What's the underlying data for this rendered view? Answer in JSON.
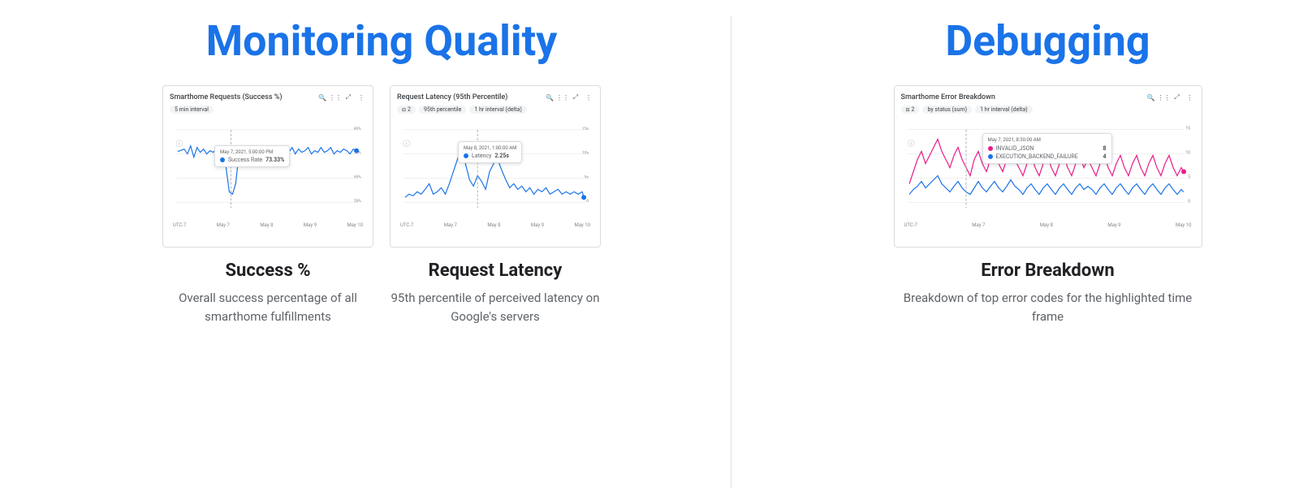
{
  "left_section": {
    "title": "Monitoring Quality",
    "charts": [
      {
        "id": "success-rate-chart",
        "title": "Smarthome Requests (Success %)",
        "filters": [
          "5 min interval"
        ],
        "tooltip": {
          "date": "May 7, 2021, 5:00:00 PM",
          "metric": "Success Rate",
          "value": "73.33%"
        },
        "y_labels": [
          "80%",
          "70%",
          "60%",
          "50%"
        ],
        "x_labels": [
          "UTC-7",
          "May 7",
          "May 8",
          "May 9",
          "May 10"
        ],
        "line_color": "#1a73e8"
      },
      {
        "id": "latency-chart",
        "title": "Request Latency (95th Percentile)",
        "filters": [
          "2",
          "95th percentile",
          "1 hr interval (delta)"
        ],
        "tooltip": {
          "date": "May 8, 2021, 1:00:00 AM",
          "metric": "Latency",
          "value": "2.25s"
        },
        "y_labels": [
          "15s",
          "10s",
          "5s",
          "0"
        ],
        "x_labels": [
          "UTC-7",
          "May 7",
          "May 8",
          "May 9",
          "May 10"
        ],
        "line_color": "#1a73e8"
      }
    ],
    "info": [
      {
        "title": "Success %",
        "description": "Overall success percentage of all smarthome fulfillments"
      },
      {
        "title": "Request Latency",
        "description": "95th percentile of perceived latency on Google's servers"
      }
    ]
  },
  "right_section": {
    "title": "Debugging",
    "chart": {
      "id": "error-breakdown-chart",
      "title": "Smarthome Error Breakdown",
      "filters": [
        "2",
        "by status (sum)",
        "1 hr interval (delta)"
      ],
      "tooltip": {
        "date": "May 7, 2021, 8:30:00 AM",
        "entries": [
          {
            "metric": "INVALID_JSON",
            "value": "8",
            "color": "#e91e8c"
          },
          {
            "metric": "EXECUTION_BACKEND_FAILURE",
            "value": "4",
            "color": "#1a73e8"
          }
        ]
      },
      "y_labels": [
        "15",
        "10",
        "5",
        "0"
      ],
      "x_labels": [
        "UTC-7",
        "May 7",
        "May 8",
        "May 9",
        "May 10"
      ],
      "line_color": "#e91e8c"
    },
    "info": {
      "title": "Error Breakdown",
      "description": "Breakdown of top error codes for the highlighted time frame"
    }
  },
  "icons": {
    "search": "🔍",
    "legend": "≡",
    "expand": "⤢",
    "more": "⋮",
    "filter": "⊟"
  }
}
